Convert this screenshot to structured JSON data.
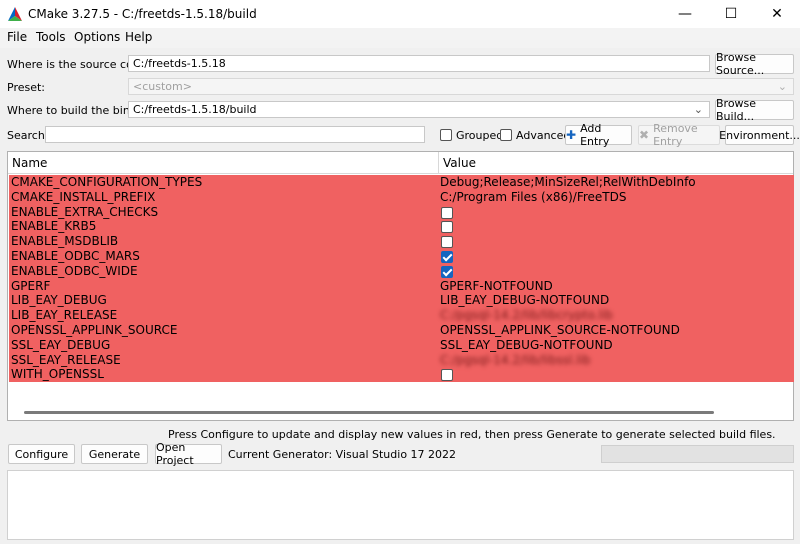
{
  "window": {
    "title": "CMake 3.27.5 - C:/freetds-1.5.18/build",
    "minimize": "—",
    "maximize": "☐",
    "close": "✕"
  },
  "menu": [
    "File",
    "Tools",
    "Options",
    "Help"
  ],
  "source": {
    "label": "Where is the source code:",
    "value": "C:/freetds-1.5.18",
    "button": "Browse Source..."
  },
  "preset": {
    "label": "Preset:",
    "value": "<custom>"
  },
  "build": {
    "label": "Where to build the binaries:",
    "value": "C:/freetds-1.5.18/build",
    "button": "Browse Build..."
  },
  "search": {
    "label": "Search:",
    "value": ""
  },
  "options": {
    "grouped": {
      "label": "Grouped",
      "checked": false
    },
    "advanced": {
      "label": "Advanced",
      "checked": false
    },
    "add_entry": "Add Entry",
    "remove_entry": "Remove Entry",
    "environment": "Environment..."
  },
  "table": {
    "columns": [
      "Name",
      "Value"
    ],
    "row_color": "#f06161",
    "rows": [
      {
        "name": "CMAKE_CONFIGURATION_TYPES",
        "type": "text",
        "value": "Debug;Release;MinSizeRel;RelWithDebInfo"
      },
      {
        "name": "CMAKE_INSTALL_PREFIX",
        "type": "text",
        "value": "C:/Program Files (x86)/FreeTDS"
      },
      {
        "name": "ENABLE_EXTRA_CHECKS",
        "type": "bool",
        "checked": false
      },
      {
        "name": "ENABLE_KRB5",
        "type": "bool",
        "checked": false
      },
      {
        "name": "ENABLE_MSDBLIB",
        "type": "bool",
        "checked": false
      },
      {
        "name": "ENABLE_ODBC_MARS",
        "type": "bool",
        "checked": true
      },
      {
        "name": "ENABLE_ODBC_WIDE",
        "type": "bool",
        "checked": true
      },
      {
        "name": "GPERF",
        "type": "text",
        "value": "GPERF-NOTFOUND"
      },
      {
        "name": "LIB_EAY_DEBUG",
        "type": "text",
        "value": "LIB_EAY_DEBUG-NOTFOUND"
      },
      {
        "name": "LIB_EAY_RELEASE",
        "type": "text",
        "value": "C:/pgsql-14.2/lib/libcrypto.lib",
        "blurred": true
      },
      {
        "name": "OPENSSL_APPLINK_SOURCE",
        "type": "text",
        "value": "OPENSSL_APPLINK_SOURCE-NOTFOUND"
      },
      {
        "name": "SSL_EAY_DEBUG",
        "type": "text",
        "value": "SSL_EAY_DEBUG-NOTFOUND"
      },
      {
        "name": "SSL_EAY_RELEASE",
        "type": "text",
        "value": "C:/pgsql-14.2/lib/libssl.lib",
        "blurred": true
      },
      {
        "name": "WITH_OPENSSL",
        "type": "bool",
        "checked": false
      }
    ]
  },
  "status_message": "Press Configure to update and display new values in red, then press Generate to generate selected build files.",
  "actions": {
    "configure": "Configure",
    "generate": "Generate",
    "open_project": "Open Project",
    "generator": "Current Generator: Visual Studio 17 2022"
  }
}
